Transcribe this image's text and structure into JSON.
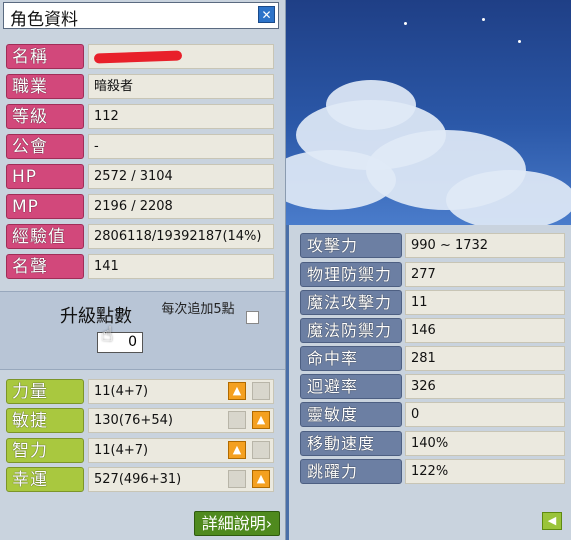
{
  "window": {
    "title": "角色資料",
    "close_icon": "close-icon"
  },
  "info": [
    {
      "label": "名稱",
      "value": ""
    },
    {
      "label": "職業",
      "value": "暗殺者"
    },
    {
      "label": "等級",
      "value": "112"
    },
    {
      "label": "公會",
      "value": "-"
    },
    {
      "label": "HP",
      "value": "2572 / 3104"
    },
    {
      "label": "MP",
      "value": "2196 / 2208"
    },
    {
      "label": "經驗值",
      "value": "2806118/19392187(14%)"
    },
    {
      "label": "名聲",
      "value": "141"
    }
  ],
  "ap": {
    "label": "升級點數",
    "value": "0",
    "each_add_label": "每次追加5點"
  },
  "stats": [
    {
      "label": "力量",
      "value": "11(4+7)"
    },
    {
      "label": "敏捷",
      "value": "130(76+54)"
    },
    {
      "label": "智力",
      "value": "11(4+7)"
    },
    {
      "label": "幸運",
      "value": "527(496+31)"
    }
  ],
  "detail_button": "詳細說明",
  "detail": [
    {
      "label": "攻擊力",
      "value": "990 ~ 1732"
    },
    {
      "label": "物理防禦力",
      "value": "277"
    },
    {
      "label": "魔法攻擊力",
      "value": "11"
    },
    {
      "label": "魔法防禦力",
      "value": "146"
    },
    {
      "label": "命中率",
      "value": "281"
    },
    {
      "label": "迴避率",
      "value": "326"
    },
    {
      "label": "靈敏度",
      "value": "0"
    },
    {
      "label": "移動速度",
      "value": "140%"
    },
    {
      "label": "跳躍力",
      "value": "122%"
    }
  ],
  "colors": {
    "pink": "#d2487b",
    "green": "#a9c83f",
    "blue_label": "#6c7fa3",
    "up_arrow": "#f4a020"
  }
}
